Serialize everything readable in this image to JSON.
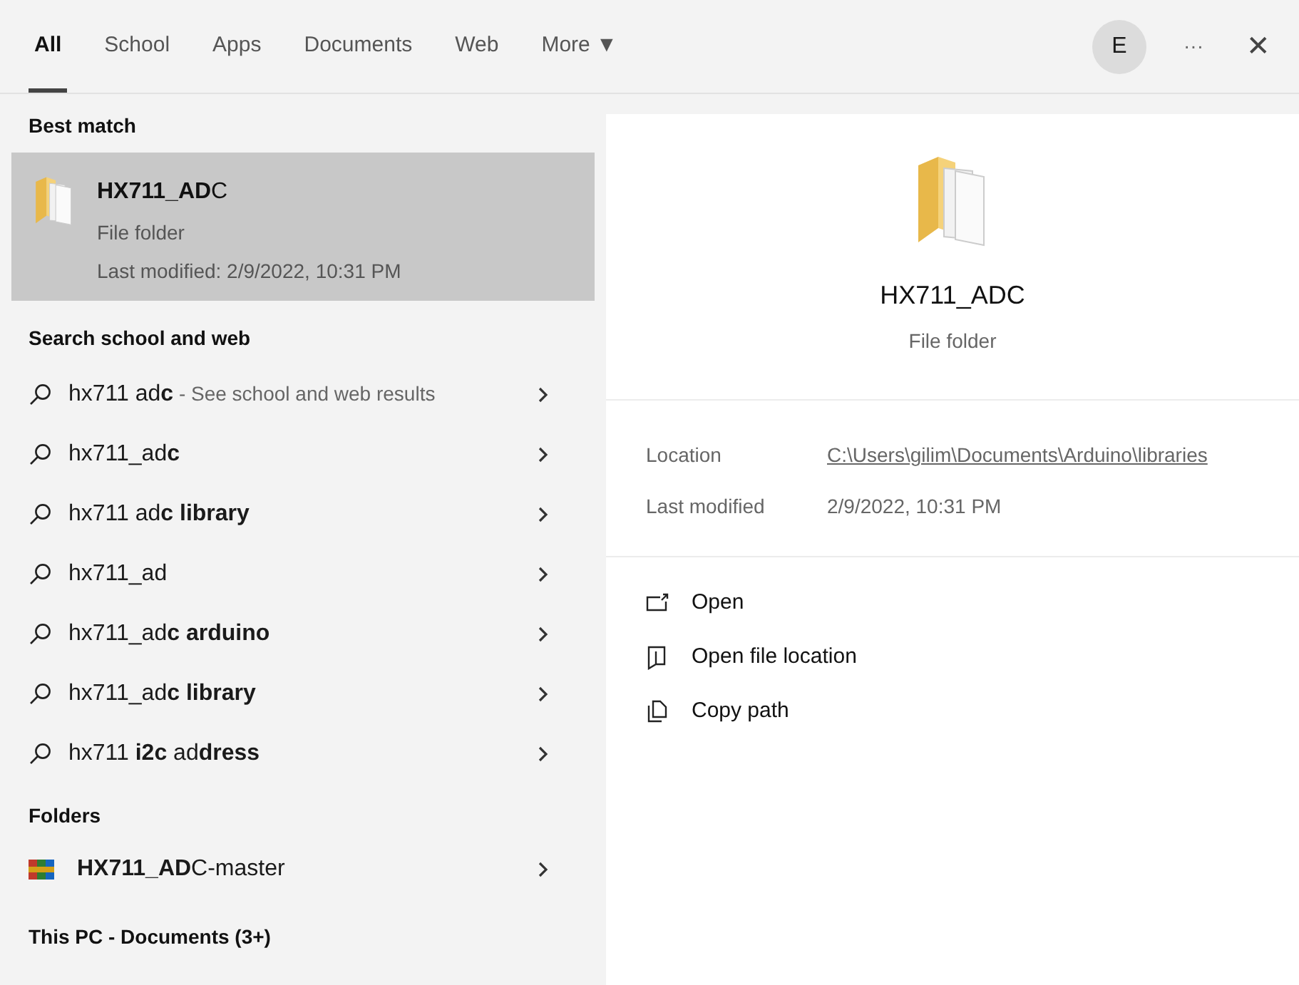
{
  "tabs": [
    {
      "label": "All",
      "selected": true
    },
    {
      "label": "School",
      "selected": false
    },
    {
      "label": "Apps",
      "selected": false
    },
    {
      "label": "Documents",
      "selected": false
    },
    {
      "label": "Web",
      "selected": false
    },
    {
      "label": "More ▼",
      "selected": false
    }
  ],
  "header": {
    "avatar": "E",
    "more": "···",
    "close": "✕"
  },
  "best_match": {
    "heading": "Best match",
    "item": {
      "title": "**HX711_AD**C",
      "type": "File folder",
      "modified": "Last modified: 2/9/2022, 10:31 PM",
      "selected": true
    }
  },
  "web": {
    "heading": "Search school and web",
    "items": [
      {
        "text": "hx711 ad**c**",
        "hint": " - See school and web results"
      },
      {
        "text": "hx711_ad**c**"
      },
      {
        "text": "hx711 ad**c library**"
      },
      {
        "text": "hx711_ad"
      },
      {
        "text": "hx711_ad**c arduino**"
      },
      {
        "text": "hx711_ad**c library**"
      },
      {
        "text": "hx711 **i2c** ad**dress**"
      }
    ]
  },
  "folders": {
    "heading": "Folders",
    "items": [
      {
        "text": "**HX711_AD**C-master"
      }
    ]
  },
  "more_heading": "This PC - Documents (3+)",
  "preview": {
    "title": "HX711_ADC",
    "type": "File folder",
    "details": [
      {
        "label": "Location",
        "value": "C:\\Users\\gilim\\Documents\\Arduino\\libraries",
        "kind": "link"
      },
      {
        "label": "Last modified",
        "value": "2/9/2022, 10:31 PM",
        "kind": "text"
      }
    ],
    "actions": [
      {
        "label": "Open",
        "kind": "open"
      },
      {
        "label": "Open file location",
        "kind": "location"
      },
      {
        "label": "Copy path",
        "kind": "copy"
      }
    ]
  }
}
